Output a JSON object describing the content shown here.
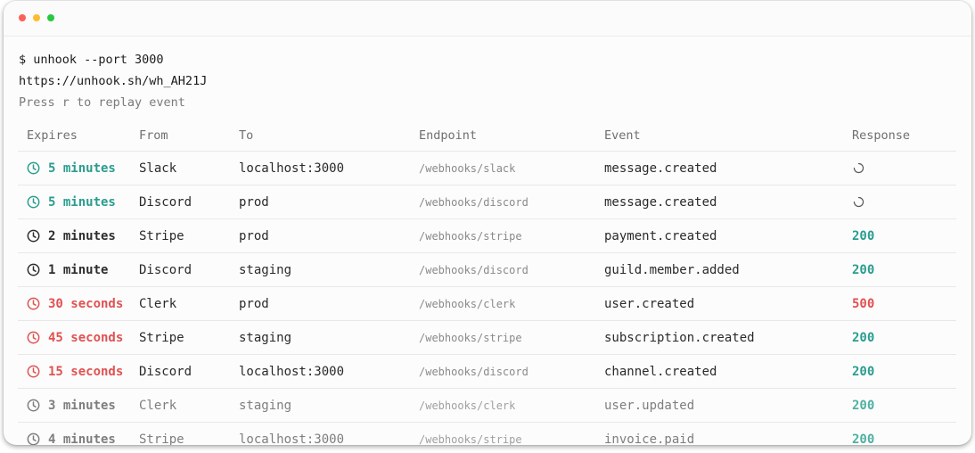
{
  "colors": {
    "teal": "#2a9d8f",
    "red": "#e05252",
    "dark": "#2e2e2e",
    "gray": "#7e7e7e",
    "traffic_red": "#ff5f57",
    "traffic_yellow": "#febc2e",
    "traffic_green": "#28c840"
  },
  "terminal": {
    "command": "$ unhook --port 3000",
    "url": "https://unhook.sh/wh_AH21J",
    "hint": "Press r to replay event"
  },
  "table": {
    "headers": [
      "Expires",
      "From",
      "To",
      "Endpoint",
      "Event",
      "Response"
    ],
    "rows": [
      {
        "expires": "5 minutes",
        "expires_tone": "teal",
        "from": "Slack",
        "to": "localhost:3000",
        "endpoint": "/webhooks/slack",
        "event": "message.created",
        "response": "",
        "response_status": "pending",
        "muted": false
      },
      {
        "expires": "5 minutes",
        "expires_tone": "teal",
        "from": "Discord",
        "to": "prod",
        "endpoint": "/webhooks/discord",
        "event": "message.created",
        "response": "",
        "response_status": "pending",
        "muted": false
      },
      {
        "expires": "2 minutes",
        "expires_tone": "dark",
        "from": "Stripe",
        "to": "prod",
        "endpoint": "/webhooks/stripe",
        "event": "payment.created",
        "response": "200",
        "response_status": "ok",
        "muted": false
      },
      {
        "expires": "1 minute",
        "expires_tone": "dark",
        "from": "Discord",
        "to": "staging",
        "endpoint": "/webhooks/discord",
        "event": "guild.member.added",
        "response": "200",
        "response_status": "ok",
        "muted": false
      },
      {
        "expires": "30 seconds",
        "expires_tone": "red",
        "from": "Clerk",
        "to": "prod",
        "endpoint": "/webhooks/clerk",
        "event": "user.created",
        "response": "500",
        "response_status": "error",
        "muted": false
      },
      {
        "expires": "45 seconds",
        "expires_tone": "red",
        "from": "Stripe",
        "to": "staging",
        "endpoint": "/webhooks/stripe",
        "event": "subscription.created",
        "response": "200",
        "response_status": "ok",
        "muted": false
      },
      {
        "expires": "15 seconds",
        "expires_tone": "red",
        "from": "Discord",
        "to": "localhost:3000",
        "endpoint": "/webhooks/discord",
        "event": "channel.created",
        "response": "200",
        "response_status": "ok",
        "muted": false
      },
      {
        "expires": "3 minutes",
        "expires_tone": "gray",
        "from": "Clerk",
        "to": "staging",
        "endpoint": "/webhooks/clerk",
        "event": "user.updated",
        "response": "200",
        "response_status": "ok",
        "muted": true
      },
      {
        "expires": "4 minutes",
        "expires_tone": "gray",
        "from": "Stripe",
        "to": "localhost:3000",
        "endpoint": "/webhooks/stripe",
        "event": "invoice.paid",
        "response": "200",
        "response_status": "ok",
        "muted": true
      }
    ]
  },
  "icons": {
    "expires": "clock-icon",
    "pending": "loading-spinner-icon"
  }
}
